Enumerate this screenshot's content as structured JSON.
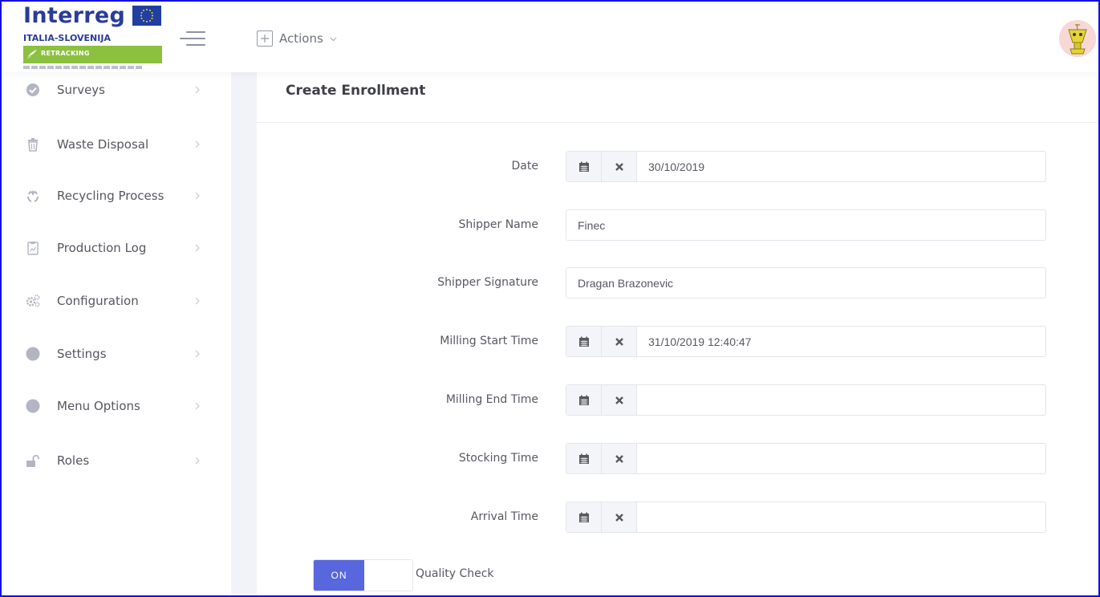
{
  "brand": {
    "name": "Interreg",
    "region": "ITALIA-SLOVENIJA",
    "project": "RETRACKING"
  },
  "header": {
    "actions_label": "Actions"
  },
  "sidebar": {
    "items": [
      {
        "label": "Surveys",
        "icon": "check-circle-icon"
      },
      {
        "label": "Waste Disposal",
        "icon": "trash-icon"
      },
      {
        "label": "Recycling Process",
        "icon": "recycle-icon"
      },
      {
        "label": "Production Log",
        "icon": "clipboard-chart-icon"
      },
      {
        "label": "Configuration",
        "icon": "gears-icon"
      },
      {
        "label": "Settings",
        "icon": "circle-icon"
      },
      {
        "label": "Menu Options",
        "icon": "circle-icon"
      },
      {
        "label": "Roles",
        "icon": "unlock-icon"
      }
    ]
  },
  "page": {
    "title": "Create Enrollment"
  },
  "form": {
    "date": {
      "label": "Date",
      "value": "30/10/2019"
    },
    "shipper_name": {
      "label": "Shipper Name",
      "value": "Finec"
    },
    "shipper_signature": {
      "label": "Shipper Signature",
      "value": "Dragan Brazonevic"
    },
    "milling_start_time": {
      "label": "Milling Start Time",
      "value": "31/10/2019 12:40:47"
    },
    "milling_end_time": {
      "label": "Milling End Time",
      "value": ""
    },
    "stocking_time": {
      "label": "Stocking Time",
      "value": ""
    },
    "arrival_time": {
      "label": "Arrival Time",
      "value": ""
    },
    "quality_check": {
      "label": "Quality Check",
      "state_label": "ON",
      "checked": true
    }
  },
  "colors": {
    "accent": "#5867dd",
    "brand_blue": "#2a3c99",
    "brand_green": "#8cc03f",
    "sidebar_gutter": "#f2f3f8"
  }
}
